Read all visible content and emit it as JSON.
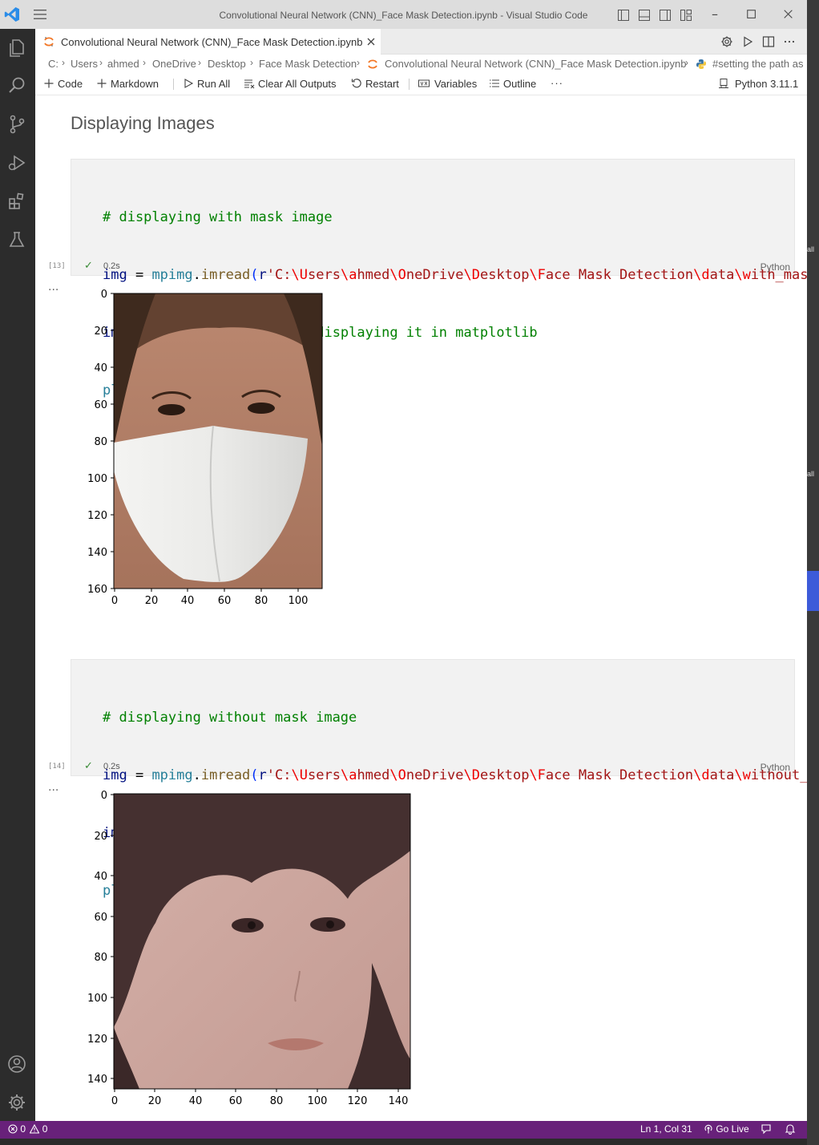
{
  "window": {
    "title": "Convolutional Neural Network (CNN)_Face Mask Detection.ipynb - Visual Studio Code"
  },
  "tab": {
    "label": "Convolutional Neural Network (CNN)_Face Mask Detection.ipynb"
  },
  "breadcrumb": {
    "items": [
      "C:",
      "Users",
      "ahmed",
      "OneDrive",
      "Desktop",
      "Face Mask Detection",
      "Convolutional Neural Network (CNN)_Face Mask Detection.ipynb",
      "#setting the path as"
    ]
  },
  "toolbar": {
    "code": "Code",
    "markdown": "Markdown",
    "run_all": "Run All",
    "clear_outputs": "Clear All Outputs",
    "restart": "Restart",
    "variables": "Variables",
    "outline": "Outline",
    "more": "···",
    "kernel": "Python 3.11.1"
  },
  "notebook": {
    "heading": "Displaying Images",
    "cells": [
      {
        "exec_count": "[13]",
        "lines": [
          "# displaying with mask image",
          "img = mpimg.imread(r'C:\\Users\\ahmed\\OneDrive\\Desktop\\Face Mask Detection\\data\\with_mask",
          "imgplot = plt.imshow(img)#displaying it in matplotlib",
          "plt.show()"
        ],
        "time": "0.2s",
        "language": "Python",
        "output_dots": "...",
        "plot": {
          "x_ticks": [
            "0",
            "20",
            "40",
            "60",
            "80",
            "100"
          ],
          "y_ticks": [
            "0",
            "20",
            "40",
            "60",
            "80",
            "100",
            "120",
            "140",
            "160"
          ]
        }
      },
      {
        "exec_count": "[14]",
        "lines": [
          "# displaying without mask image",
          "img = mpimg.imread(r'C:\\Users\\ahmed\\OneDrive\\Desktop\\Face Mask Detection\\data\\without_ma",
          "imgplot = plt.imshow(img)",
          "plt.show()"
        ],
        "time": "0.2s",
        "language": "Python",
        "output_dots": "...",
        "plot": {
          "x_ticks": [
            "0",
            "20",
            "40",
            "60",
            "80",
            "100",
            "120",
            "140"
          ],
          "y_ticks": [
            "0",
            "20",
            "40",
            "60",
            "80",
            "100",
            "120",
            "140"
          ]
        }
      }
    ]
  },
  "statusbar": {
    "errors": "0",
    "warnings": "0",
    "position": "Ln 1, Col 31",
    "go_live": "Go Live"
  },
  "right_strip": {
    "label1": "all",
    "label2": "all"
  },
  "colors": {
    "statusbar": "#68217a",
    "activitybar": "#2c2c2c",
    "comment": "#008000",
    "string": "#a31515"
  }
}
